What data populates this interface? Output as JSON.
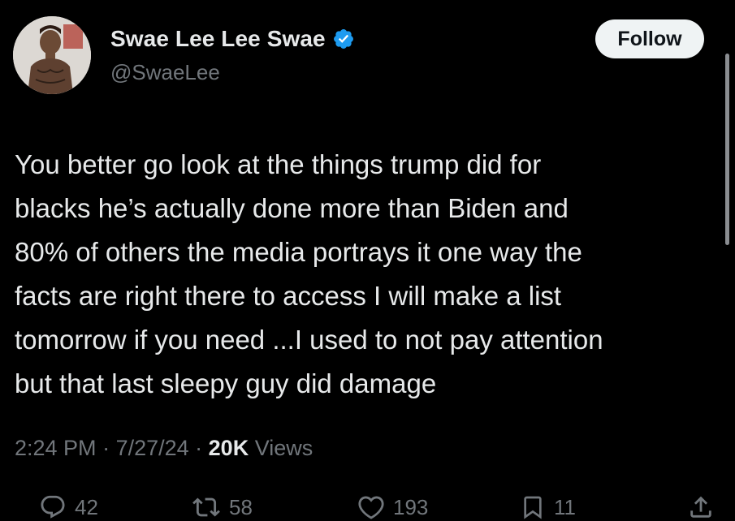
{
  "user": {
    "display_name": "Swae Lee Lee Swae",
    "handle": "@SwaeLee",
    "verified_color": "#1d9bf0",
    "follow_label": "Follow"
  },
  "tweet": {
    "lines": [
      "You better go look at the things trump did for",
      "blacks he’s actually done more than Biden and",
      "80% of others the media portrays it one way the",
      "facts are right there to access I will make a list",
      "tomorrow if you need ...I used to not pay attention",
      "but that last sleepy guy did damage"
    ]
  },
  "meta": {
    "time": "2:24 PM",
    "sep1": " · ",
    "date": "7/27/24",
    "sep2": " · ",
    "views_count": "20K",
    "views_label": " Views"
  },
  "actions": {
    "replies": "42",
    "retweets": "58",
    "likes": "193",
    "bookmarks": "11"
  },
  "icons": {
    "reply": "reply-icon",
    "retweet": "retweet-icon",
    "like": "heart-icon",
    "bookmark": "bookmark-icon",
    "share": "share-icon",
    "verified": "verified-badge-icon"
  }
}
